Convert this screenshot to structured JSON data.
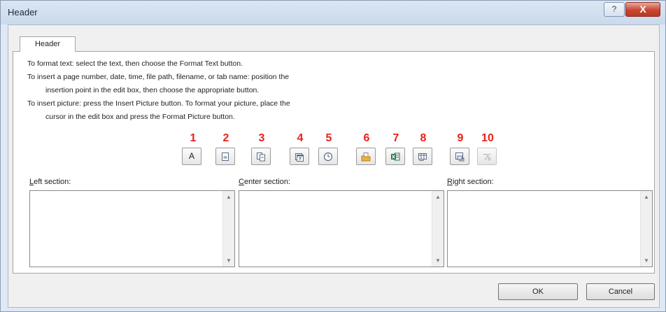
{
  "window": {
    "title": "Header"
  },
  "tab": {
    "label": "Header"
  },
  "instructions": [
    "To format text:  select the text, then choose the Format Text button.",
    "To insert a page number, date, time, file path, filename, or tab name:  position the",
    "insertion point in the edit box, then choose the appropriate button.",
    "To insert picture: press the Insert Picture button.  To format your picture, place the",
    "cursor in the edit box and press the Format Picture button."
  ],
  "button_numbers": [
    "1",
    "2",
    "3",
    "4",
    "5",
    "6",
    "7",
    "8",
    "9",
    "10"
  ],
  "toolbar": {
    "format_text_glyph": "A"
  },
  "sections": {
    "left": {
      "access_key": "L",
      "rest": "eft section:"
    },
    "center": {
      "access_key": "C",
      "rest": "enter section:"
    },
    "right": {
      "access_key": "R",
      "rest": "ight section:"
    }
  },
  "buttons": {
    "ok": "OK",
    "cancel": "Cancel"
  },
  "title_buttons": {
    "help": "?",
    "close": "X"
  },
  "colors": {
    "annotation_number": "#e8211b",
    "excel_green": "#1e7145",
    "folder_yellow": "#e8b040"
  }
}
